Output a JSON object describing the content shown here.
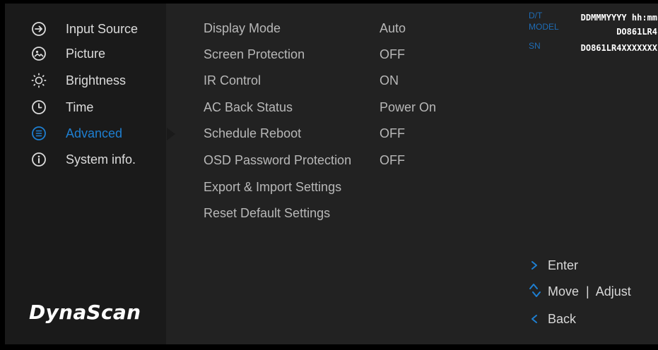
{
  "menu": {
    "items": [
      {
        "label": "Input Source",
        "icon": "input-source-icon"
      },
      {
        "label": "Picture",
        "icon": "picture-icon"
      },
      {
        "label": "Brightness",
        "icon": "brightness-icon"
      },
      {
        "label": "Time",
        "icon": "clock-icon"
      },
      {
        "label": "Advanced",
        "icon": "advanced-icon",
        "active": true
      },
      {
        "label": "System info.",
        "icon": "info-icon"
      }
    ]
  },
  "logo": {
    "text": "DynaScan"
  },
  "settings": [
    {
      "label": "Display Mode",
      "value": "Auto"
    },
    {
      "label": "Screen Protection",
      "value": "OFF"
    },
    {
      "label": "IR Control",
      "value": "ON"
    },
    {
      "label": "AC Back Status",
      "value": "Power On"
    },
    {
      "label": "Schedule Reboot",
      "value": "OFF"
    },
    {
      "label": "OSD Password Protection",
      "value": "OFF"
    },
    {
      "label": "Export & Import Settings",
      "value": ""
    },
    {
      "label": "Reset Default Settings",
      "value": ""
    }
  ],
  "device_info": {
    "dt_label": "D/T",
    "dt_value": "DDMMMYYYY hh:mm",
    "model_label": "MODEL",
    "model_value": "DO861LR4",
    "sn_label": "SN",
    "sn_value": "DO861LR4XXXXXXX"
  },
  "hints": {
    "enter_symbol": ">",
    "enter": "Enter",
    "move_adjust": "Move  |  Adjust",
    "back_symbol": "<",
    "back": "Back"
  },
  "colors": {
    "accent": "#1e7fd1",
    "info_label": "#1e6cb5",
    "text": "#dcdcdc",
    "setting_text": "#b8b8b8",
    "left_panel": "#1a1a1a",
    "main_panel": "#222222",
    "background": "#000000"
  }
}
